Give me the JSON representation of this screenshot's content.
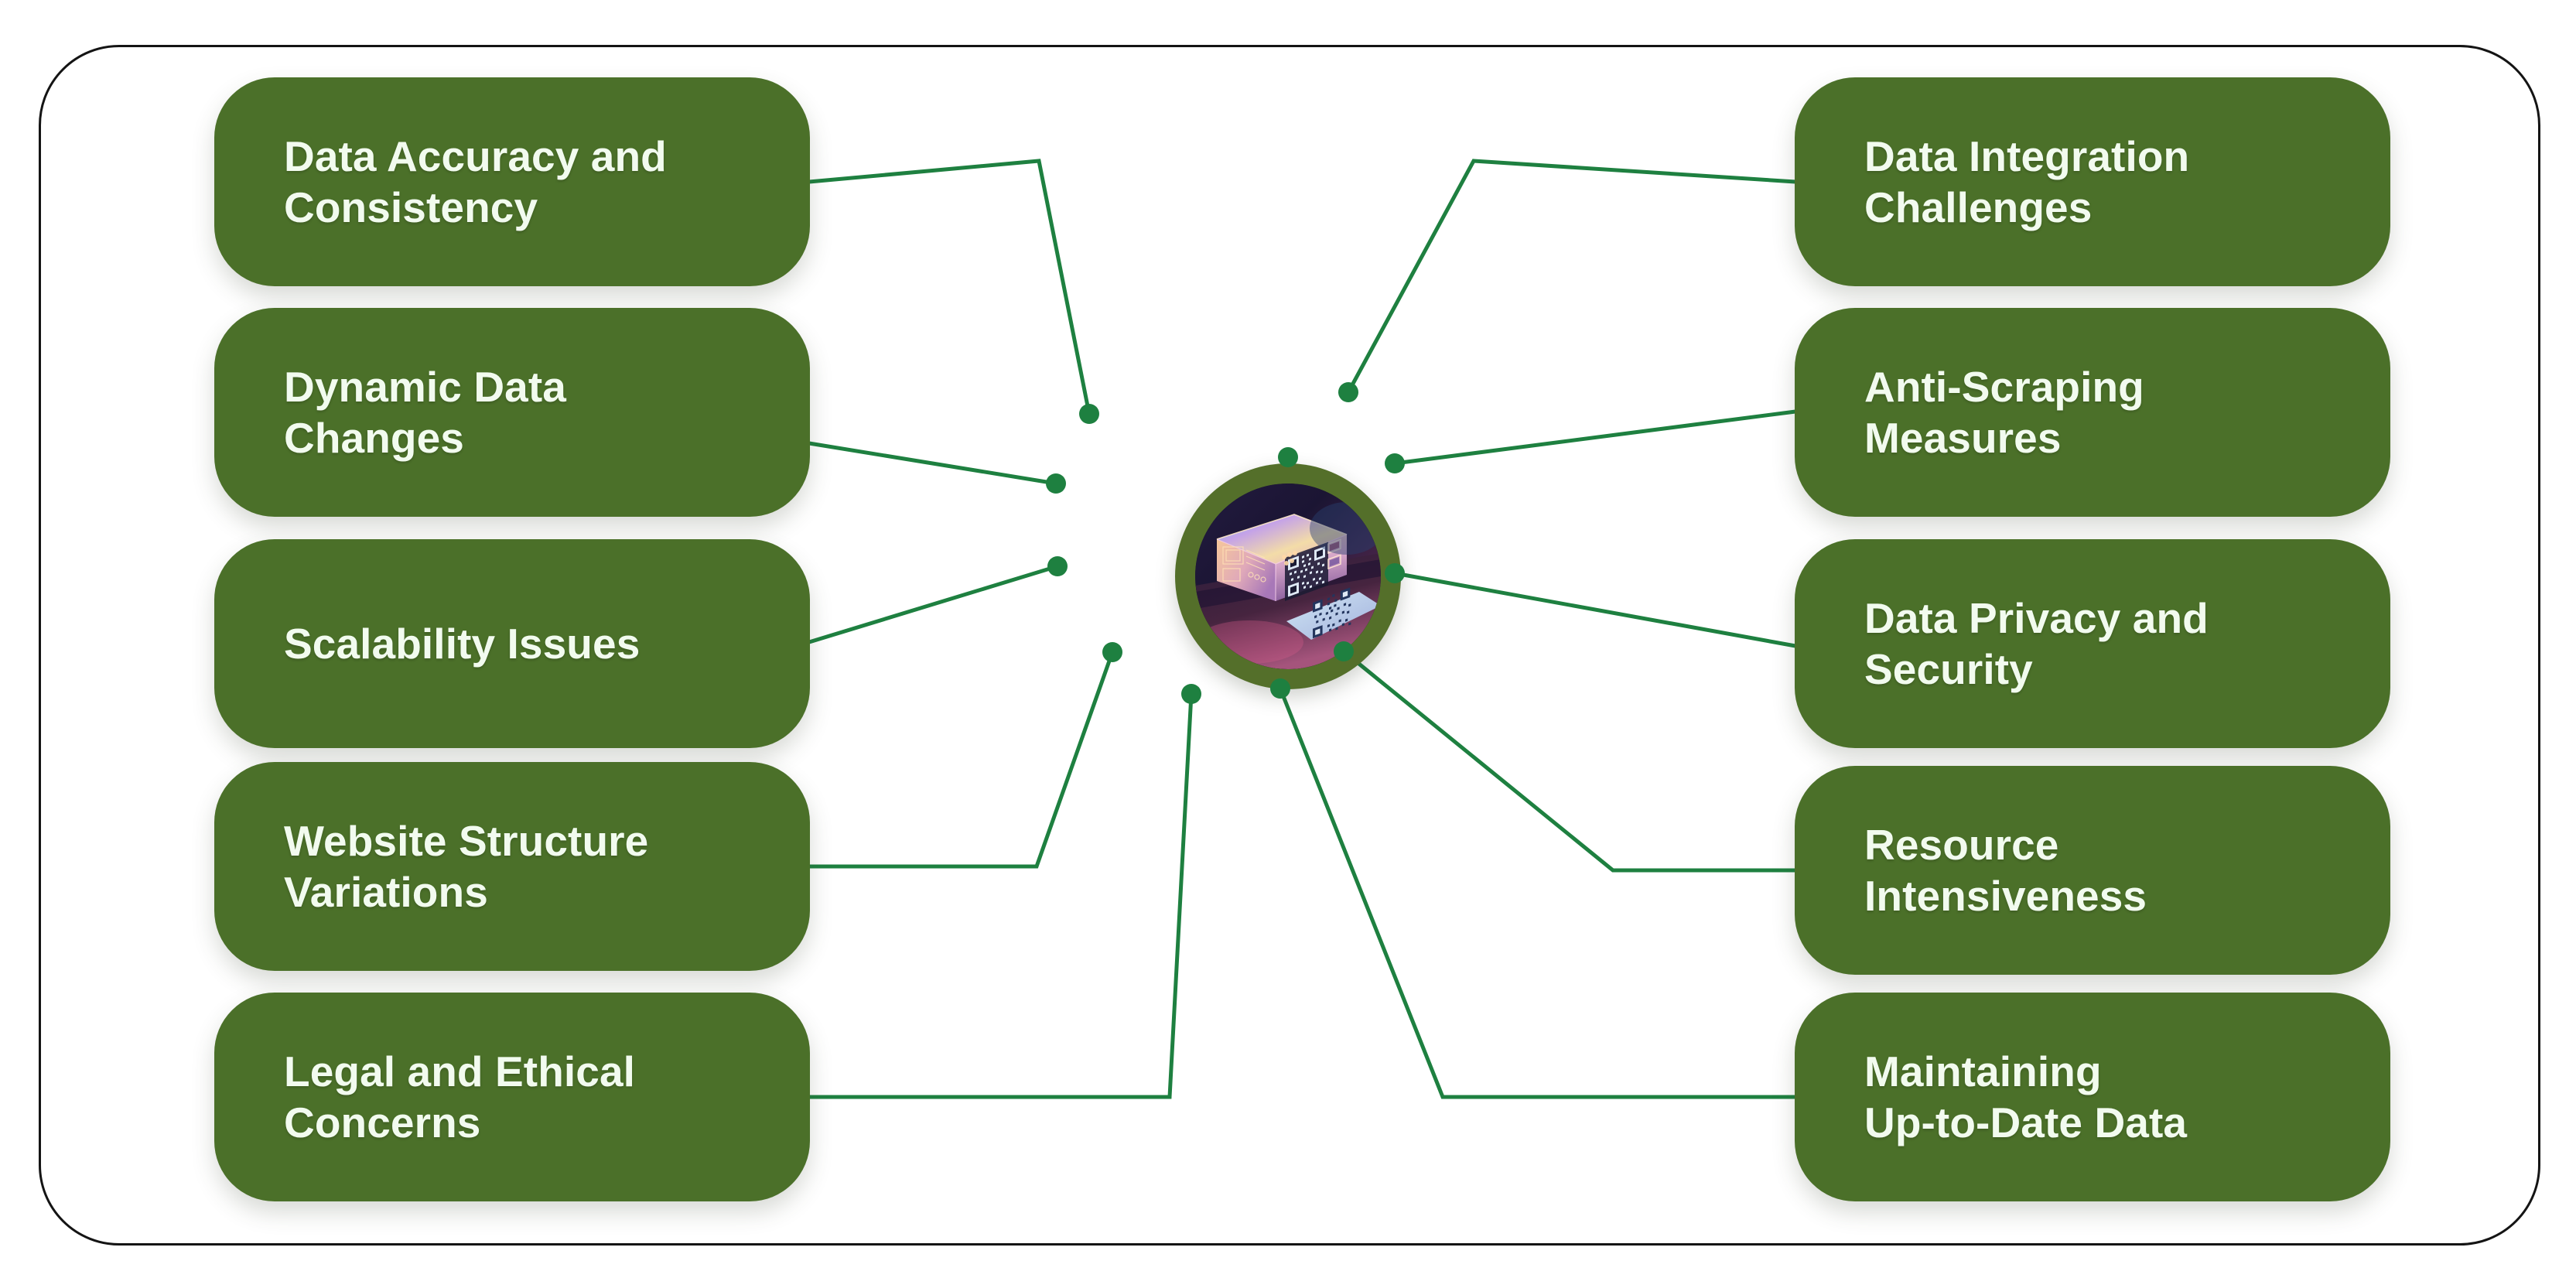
{
  "diagram": {
    "title_semantic": "web-scraping-challenges-hub-and-spoke",
    "colors": {
      "pill_green": "#4B7029",
      "hub_ring_green": "#546F2A",
      "connector_green": "#1E8040",
      "dot_green": "#1E8040",
      "frame_border": "#141414",
      "label_text": "#F2FBEF",
      "background": "#FFFFFF"
    },
    "hub": {
      "name": "central-image",
      "description": "QR code on a neon-lit cardboard package",
      "dot_count": 10
    },
    "left_nodes": [
      {
        "id": "data-accuracy-and-consistency",
        "label": "Data Accuracy and\nConsistency"
      },
      {
        "id": "dynamic-data-changes",
        "label": "Dynamic Data\nChanges"
      },
      {
        "id": "scalability-issues",
        "label": "Scalability Issues"
      },
      {
        "id": "website-structure-variations",
        "label": "Website Structure\nVariations"
      },
      {
        "id": "legal-and-ethical-concerns",
        "label": "Legal and Ethical\nConcerns"
      }
    ],
    "right_nodes": [
      {
        "id": "data-integration-challenges",
        "label": "Data Integration\nChallenges"
      },
      {
        "id": "anti-scraping-measures",
        "label": "Anti-Scraping\nMeasures"
      },
      {
        "id": "data-privacy-and-security",
        "label": "Data Privacy and\nSecurity"
      },
      {
        "id": "resource-intensiveness",
        "label": "Resource\nIntensiveness"
      },
      {
        "id": "maintaining-up-to-date-data",
        "label": "Maintaining\nUp-to-Date Data"
      }
    ]
  }
}
